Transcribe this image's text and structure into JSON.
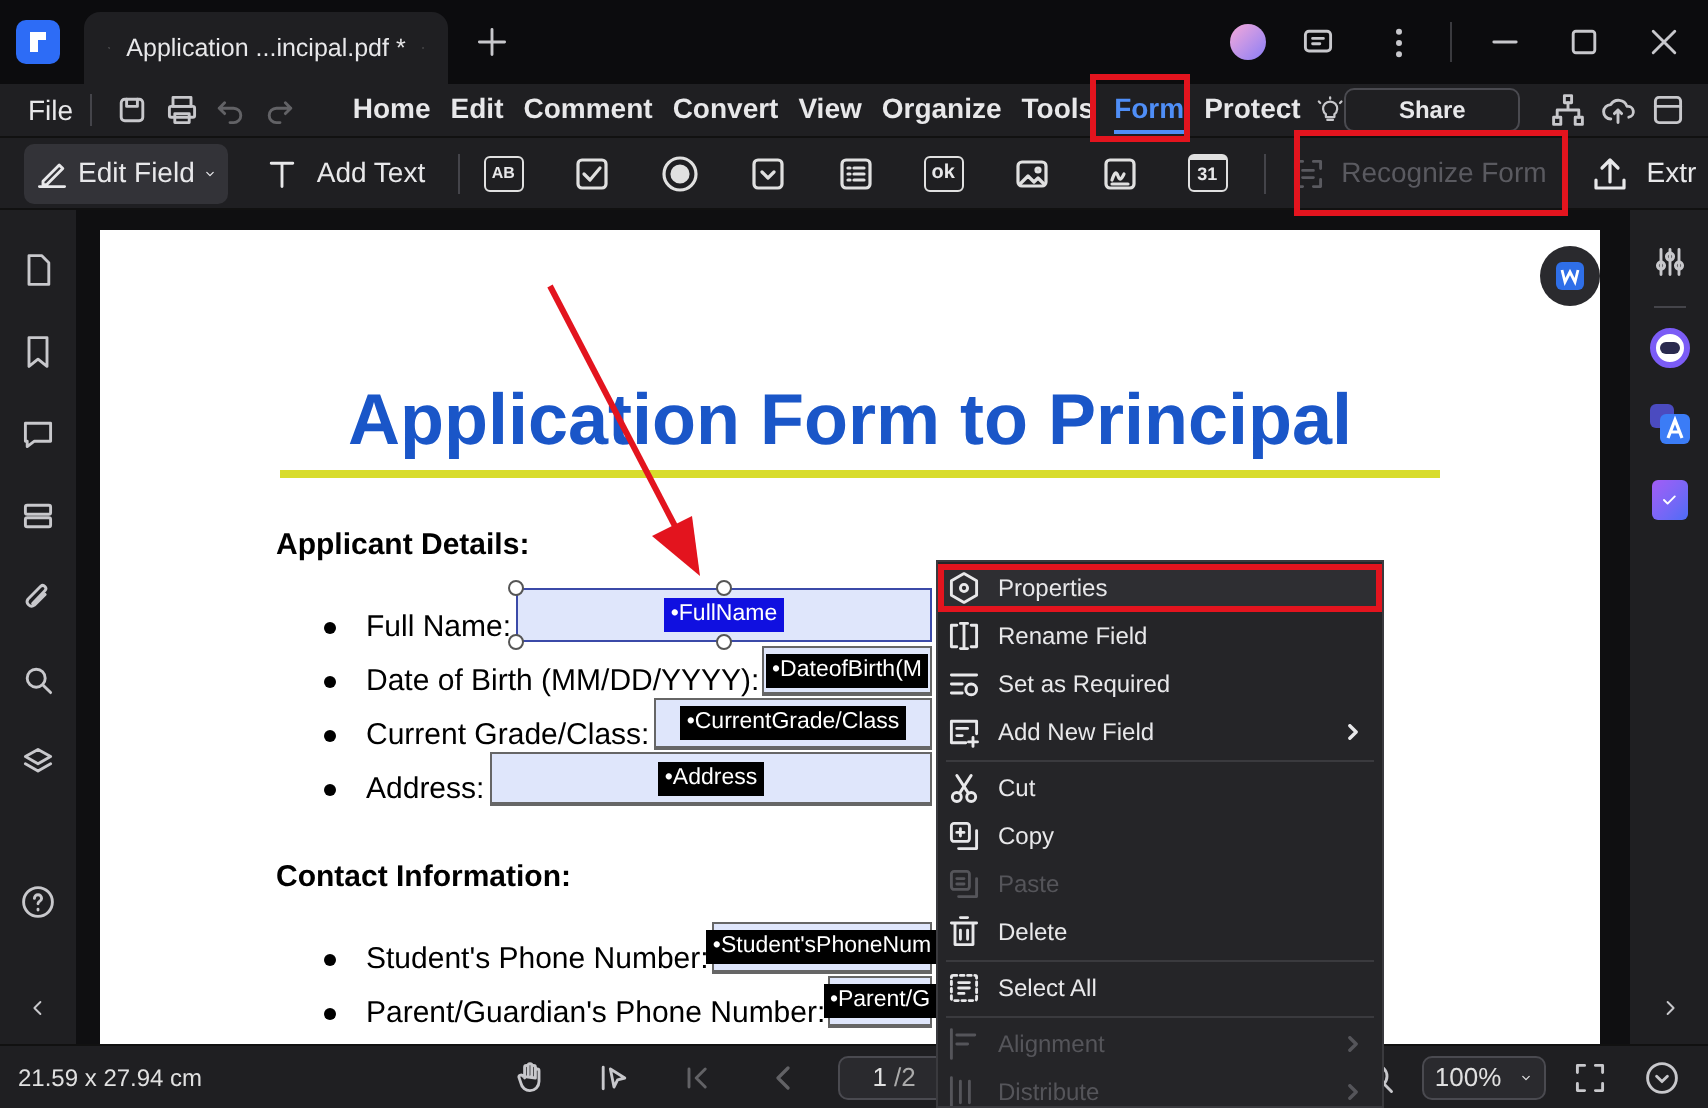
{
  "title_bar": {
    "tab_title": "Application ...incipal.pdf *"
  },
  "menu_bar": {
    "file": "File",
    "tabs": [
      {
        "label": "Home",
        "selected": false
      },
      {
        "label": "Edit",
        "selected": false
      },
      {
        "label": "Comment",
        "selected": false
      },
      {
        "label": "Convert",
        "selected": false
      },
      {
        "label": "View",
        "selected": false
      },
      {
        "label": "Organize",
        "selected": false
      },
      {
        "label": "Tools",
        "selected": false
      },
      {
        "label": "Form",
        "selected": true
      },
      {
        "label": "Protect",
        "selected": false
      }
    ],
    "share": "Share"
  },
  "toolbar": {
    "edit_field": "Edit Field",
    "add_text": "Add Text",
    "field_tools": [
      {
        "kind": "text",
        "label": "AB"
      },
      {
        "kind": "checkbox"
      },
      {
        "kind": "radio"
      },
      {
        "kind": "dropdown"
      },
      {
        "kind": "list"
      },
      {
        "kind": "button",
        "label": "ok"
      },
      {
        "kind": "image"
      },
      {
        "kind": "signature"
      },
      {
        "kind": "date",
        "label": "31"
      }
    ],
    "recognize": {
      "label": "Recognize Form",
      "disabled": true
    },
    "extract": "Extr"
  },
  "document": {
    "title": "Application Form to Principal",
    "sections": [
      {
        "heading": "Applicant Details:",
        "items": [
          {
            "label": "Full Name:",
            "field": "•FullName",
            "selected": true
          },
          {
            "label": "Date of Birth (MM/DD/YYYY):",
            "field": "•DateofBirth(M",
            "selected": false
          },
          {
            "label": "Current Grade/Class:",
            "field": "•CurrentGrade/Class",
            "selected": false
          },
          {
            "label": "Address:",
            "field": "•Address",
            "selected": false
          }
        ]
      },
      {
        "heading": "Contact Information:",
        "items": [
          {
            "label": "Student's Phone Number:",
            "field": "•Student'sPhoneNum",
            "selected": false
          },
          {
            "label": "Parent/Guardian's Phone Number:",
            "field": "•Parent/G",
            "selected": false
          }
        ]
      }
    ]
  },
  "context_menu": [
    {
      "kind": "item",
      "label": "Properties",
      "disabled": false,
      "submenu": false,
      "highlighted": true
    },
    {
      "kind": "item",
      "label": "Rename Field",
      "disabled": false,
      "submenu": false,
      "highlighted": false
    },
    {
      "kind": "item",
      "label": "Set as Required",
      "disabled": false,
      "submenu": false,
      "highlighted": false
    },
    {
      "kind": "item",
      "label": "Add New Field",
      "disabled": false,
      "submenu": true,
      "highlighted": false
    },
    {
      "kind": "separator"
    },
    {
      "kind": "item",
      "label": "Cut",
      "disabled": false,
      "submenu": false,
      "highlighted": false
    },
    {
      "kind": "item",
      "label": "Copy",
      "disabled": false,
      "submenu": false,
      "highlighted": false
    },
    {
      "kind": "item",
      "label": "Paste",
      "disabled": true,
      "submenu": false,
      "highlighted": false
    },
    {
      "kind": "item",
      "label": "Delete",
      "disabled": false,
      "submenu": false,
      "highlighted": false
    },
    {
      "kind": "separator"
    },
    {
      "kind": "item",
      "label": "Select All",
      "disabled": false,
      "submenu": false,
      "highlighted": false
    },
    {
      "kind": "separator"
    },
    {
      "kind": "item",
      "label": "Alignment",
      "disabled": true,
      "submenu": true,
      "highlighted": false
    },
    {
      "kind": "item",
      "label": "Distribute",
      "disabled": true,
      "submenu": true,
      "highlighted": false
    }
  ],
  "status_bar": {
    "page_size": "21.59 x 27.94 cm",
    "page": "1",
    "page_total": "/2",
    "zoom": "100%"
  }
}
